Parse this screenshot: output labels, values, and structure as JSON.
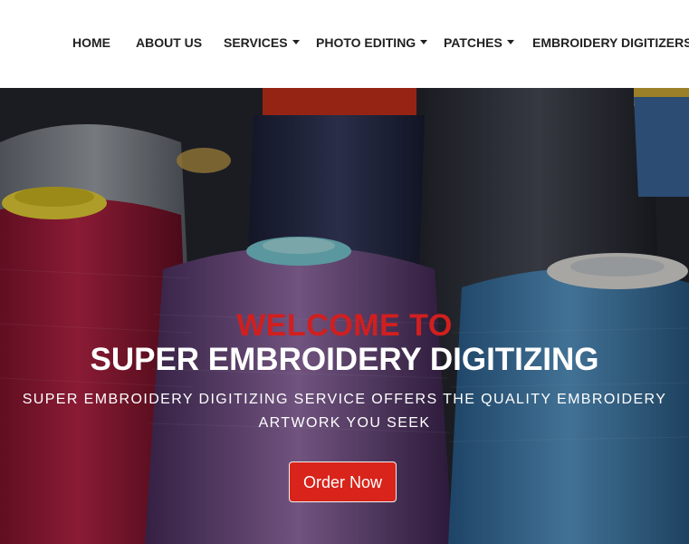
{
  "nav": {
    "items": [
      {
        "label": "HOME",
        "has_dropdown": false
      },
      {
        "label": "ABOUT US",
        "has_dropdown": false
      },
      {
        "label": "SERVICES",
        "has_dropdown": true
      },
      {
        "label": "PHOTO EDITING",
        "has_dropdown": true
      },
      {
        "label": "PATCHES",
        "has_dropdown": true
      },
      {
        "label": "EMBROIDERY DIGITIZERS",
        "has_dropdown": false
      }
    ]
  },
  "hero": {
    "welcome": "WELCOME TO",
    "title": "SUPER EMBROIDERY DIGITIZING",
    "subtitle": "SUPER EMBROIDERY DIGITIZING SERVICE OFFERS THE QUALITY EMBROIDERY ARTWORK YOU SEEK",
    "cta_label": "Order Now"
  },
  "colors": {
    "accent": "#d8241b",
    "welcome_text": "#d11f1f",
    "nav_text": "#222222"
  }
}
